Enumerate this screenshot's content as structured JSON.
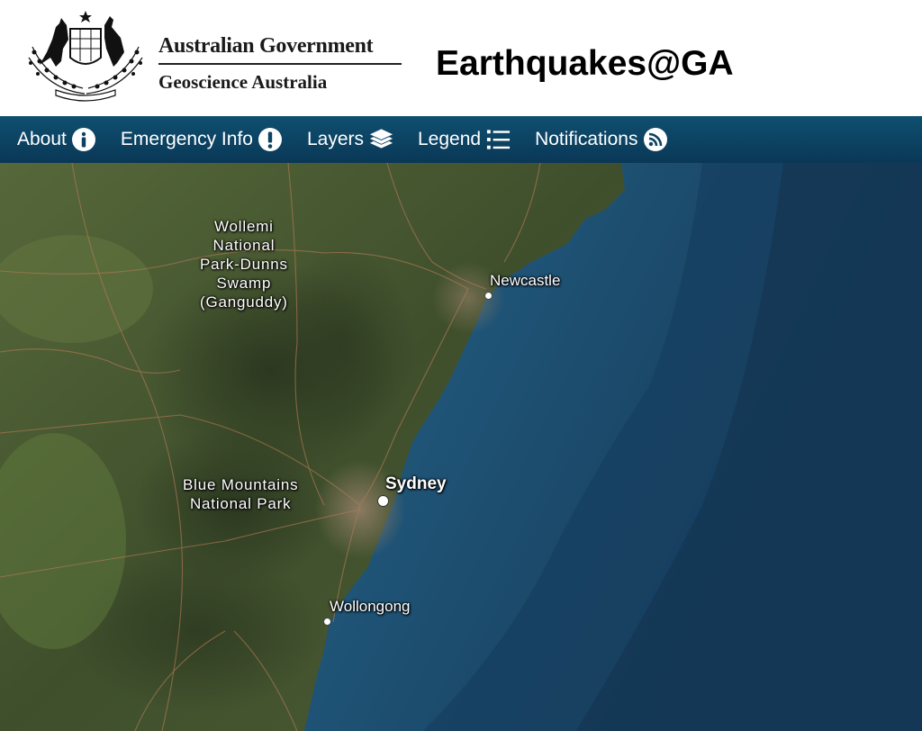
{
  "header": {
    "gov_line1": "Australian Government",
    "gov_line2": "Geoscience Australia",
    "app_title": "Earthquakes@GA",
    "crest_icon": "commonwealth-coat-of-arms-icon"
  },
  "nav": {
    "items": [
      {
        "label": "About",
        "icon": "info-icon"
      },
      {
        "label": "Emergency Info",
        "icon": "exclamation-icon"
      },
      {
        "label": "Layers",
        "icon": "layers-icon"
      },
      {
        "label": "Legend",
        "icon": "list-icon"
      },
      {
        "label": "Notifications",
        "icon": "rss-icon"
      }
    ],
    "colors": {
      "bar": "#0c4262",
      "text": "#ffffff"
    }
  },
  "map": {
    "labels": {
      "wollemi": [
        "Wollemi",
        "National",
        "Park-Dunns",
        "Swamp",
        "(Ganguddy)"
      ],
      "blue_mountains": [
        "Blue Mountains",
        "National Park"
      ],
      "newcastle": "Newcastle",
      "sydney": "Sydney",
      "wollongong": "Wollongong"
    },
    "colors": {
      "land": "#4a5a34",
      "ocean_shallow": "#2e6f93",
      "ocean_deep": "#163e5e"
    }
  }
}
